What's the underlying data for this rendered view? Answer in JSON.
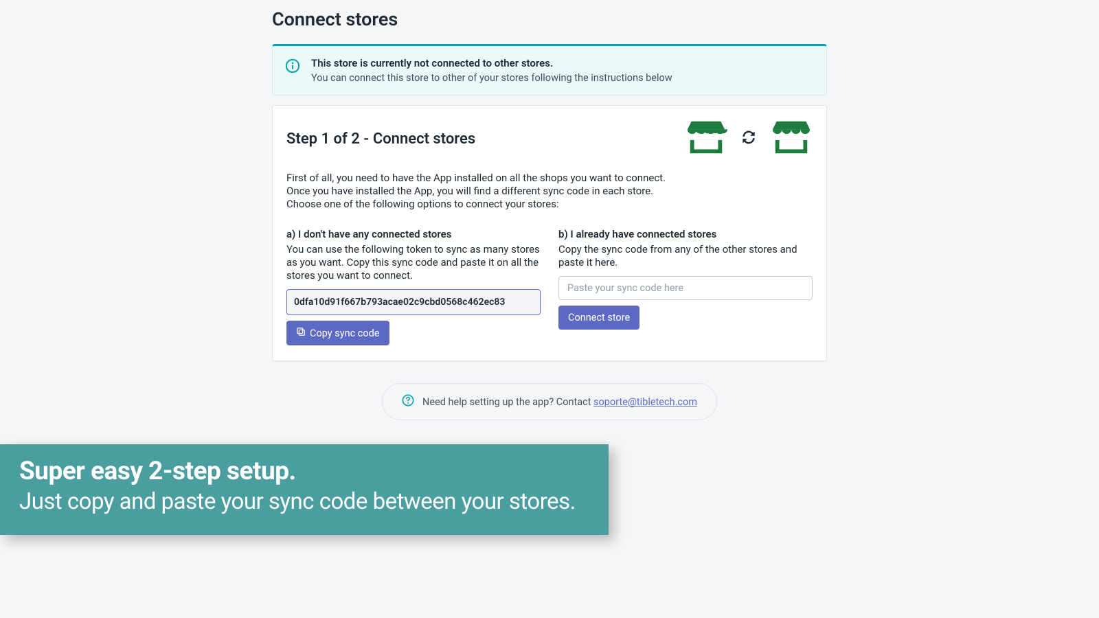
{
  "page": {
    "title": "Connect stores"
  },
  "alert": {
    "title": "This store is currently not connected to other stores.",
    "text": "You can connect this store to other of your stores following the instructions below"
  },
  "step": {
    "heading": "Step 1 of 2 - Connect stores",
    "intro_line1": "First of all, you need to have the App installed on all the shops you want to connect.",
    "intro_line2": "Once you have installed the App, you will find a different sync code in each store.",
    "intro_line3": "Choose one of the following options to connect your stores:"
  },
  "option_a": {
    "heading": "a) I don't have any connected stores",
    "text": "You can use the following token to sync as many stores as you want. Copy this sync code and paste it on all the stores you want to connect.",
    "sync_code": "0dfa10d91f667b793acae02c9cbd0568c462ec83",
    "copy_button": "Copy sync code"
  },
  "option_b": {
    "heading": "b) I already have connected stores",
    "text": "Copy the sync code from any of the other stores and paste it here.",
    "placeholder": "Paste your sync code here",
    "connect_button": "Connect store"
  },
  "help": {
    "text": "Need help setting up the app? Contact ",
    "email": "soporte@tibletech.com"
  },
  "promo": {
    "line1": "Super easy 2-step setup.",
    "line2": "Just copy and paste your sync code between your stores."
  }
}
